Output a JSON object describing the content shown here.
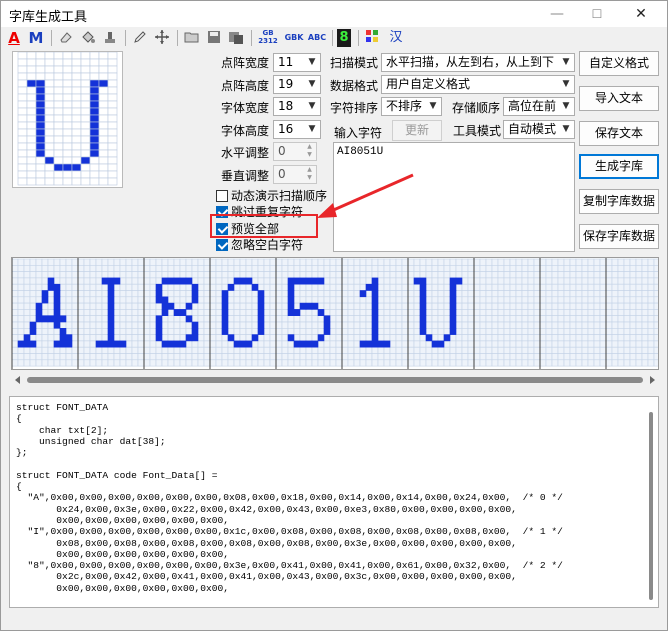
{
  "window": {
    "title": "字库生成工具",
    "min": "—",
    "max": "☐",
    "close": "✕"
  },
  "toolbar": {
    "A": "A",
    "M": "M",
    "gb": "GB\n2312",
    "gbk": "GBK",
    "abc": "ABC",
    "eight": "8",
    "han": "汉"
  },
  "settings": {
    "dot_width_label": "点阵宽度",
    "dot_width": "11",
    "dot_height_label": "点阵高度",
    "dot_height": "19",
    "font_width_label": "字体宽度",
    "font_width": "18",
    "font_height_label": "字体高度",
    "font_height": "16",
    "h_adjust_label": "水平调整",
    "h_adjust": "0",
    "v_adjust_label": "垂直调整",
    "v_adjust": "0"
  },
  "scan": {
    "scan_mode_label": "扫描模式",
    "scan_mode": "水平扫描，从左到右，从上到下",
    "data_format_label": "数据格式",
    "data_format": "用户自定义格式",
    "char_sort_label": "字符排序",
    "char_sort": "不排序",
    "store_order_label": "存储顺序",
    "store_order": "高位在前",
    "input_label": "输入字符",
    "refresh": "更新",
    "tool_mode_label": "工具模式",
    "tool_mode": "自动模式",
    "input_text": "AI8051U"
  },
  "checks": [
    {
      "label": "动态演示扫描顺序",
      "checked": false
    },
    {
      "label": "跳过重复字符",
      "checked": true
    },
    {
      "label": "预览全部",
      "checked": true
    },
    {
      "label": "忽略空白字符",
      "checked": true
    }
  ],
  "buttons": {
    "custom_format": "自定义格式",
    "import_text": "导入文本",
    "save_text": "保存文本",
    "generate": "生成字库",
    "copy_data": "复制字库数据",
    "save_data": "保存字库数据"
  },
  "glyph_chars": [
    "A",
    "I",
    "8",
    "0",
    "5",
    "1",
    "U"
  ],
  "code_text": "struct FONT_DATA\n{\n    char txt[2];\n    unsigned char dat[38];\n};\n\nstruct FONT_DATA code Font_Data[] =\n{\n  \"A\",0x00,0x00,0x00,0x00,0x00,0x00,0x08,0x00,0x18,0x00,0x14,0x00,0x14,0x00,0x24,0x00,  /* 0 */\n       0x24,0x00,0x3e,0x00,0x22,0x00,0x42,0x00,0x43,0x00,0xe3,0x80,0x00,0x00,0x00,0x00,\n       0x00,0x00,0x00,0x00,0x00,0x00,\n  \"I\",0x00,0x00,0x00,0x00,0x00,0x00,0x1c,0x00,0x08,0x00,0x08,0x00,0x08,0x00,0x08,0x00,  /* 1 */\n       0x08,0x00,0x08,0x00,0x08,0x00,0x08,0x00,0x08,0x00,0x3e,0x00,0x00,0x00,0x00,0x00,\n       0x00,0x00,0x00,0x00,0x00,0x00,\n  \"8\",0x00,0x00,0x00,0x00,0x00,0x00,0x3e,0x00,0x41,0x00,0x41,0x00,0x61,0x00,0x32,0x00,  /* 2 */\n       0x2c,0x00,0x42,0x00,0x41,0x00,0x41,0x00,0x43,0x00,0x3c,0x00,0x00,0x00,0x00,0x00,\n       0x00,0x00,0x00,0x00,0x00,0x00,"
}
